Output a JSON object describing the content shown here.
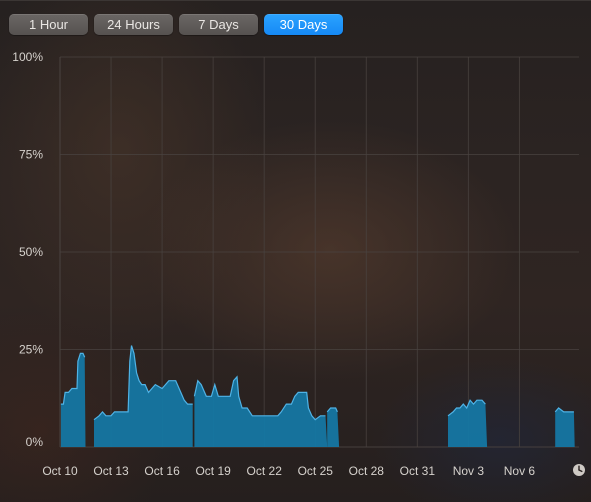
{
  "range_buttons": [
    {
      "label": "1 Hour",
      "active": false
    },
    {
      "label": "24 Hours",
      "active": false
    },
    {
      "label": "7 Days",
      "active": false
    },
    {
      "label": "30 Days",
      "active": true
    }
  ],
  "colors": {
    "accent": "#1a91f7",
    "area_fill": "#1577a3",
    "area_line": "#4fb3e6",
    "grid": "#4a4340"
  },
  "clock_icon": "clock-icon",
  "chart_data": {
    "type": "area",
    "ylabel": "",
    "xlabel": "",
    "ylim": [
      0,
      100
    ],
    "yticks": [
      0,
      25,
      50,
      75,
      100
    ],
    "ytick_labels": [
      "0%",
      "25%",
      "50%",
      "75%",
      "100%"
    ],
    "xlim": [
      0,
      30.5
    ],
    "xticks": [
      0,
      3,
      6,
      9,
      12,
      15,
      18,
      21,
      24,
      27
    ],
    "xtick_labels": [
      "Oct 10",
      "Oct 13",
      "Oct 16",
      "Oct 19",
      "Oct 22",
      "Oct 25",
      "Oct 28",
      "Oct 31",
      "Nov 3",
      "Nov 6"
    ],
    "grid": true,
    "segments": [
      {
        "name": "",
        "points": [
          [
            0.05,
            11
          ],
          [
            0.2,
            11
          ],
          [
            0.3,
            14
          ],
          [
            0.5,
            14
          ],
          [
            0.7,
            15
          ],
          [
            1.0,
            15
          ],
          [
            1.05,
            22
          ],
          [
            1.2,
            24
          ],
          [
            1.35,
            24
          ],
          [
            1.45,
            23
          ],
          [
            1.5,
            0
          ]
        ]
      },
      {
        "name": "",
        "points": [
          [
            2.0,
            7
          ],
          [
            2.3,
            8
          ],
          [
            2.5,
            9
          ],
          [
            2.7,
            8
          ],
          [
            3.0,
            8
          ],
          [
            3.2,
            9
          ],
          [
            3.6,
            9
          ],
          [
            4.0,
            9
          ],
          [
            4.1,
            22
          ],
          [
            4.2,
            26
          ],
          [
            4.35,
            24
          ],
          [
            4.5,
            19
          ],
          [
            4.65,
            17
          ],
          [
            4.8,
            16
          ],
          [
            5.0,
            16
          ],
          [
            5.2,
            14
          ],
          [
            5.6,
            16
          ],
          [
            6.0,
            15
          ],
          [
            6.4,
            17
          ],
          [
            6.8,
            17
          ],
          [
            7.1,
            14
          ],
          [
            7.3,
            12
          ],
          [
            7.5,
            11
          ],
          [
            7.8,
            11
          ]
        ]
      },
      {
        "name": "",
        "points": [
          [
            7.9,
            13
          ],
          [
            8.1,
            17
          ],
          [
            8.3,
            16
          ],
          [
            8.6,
            13
          ],
          [
            8.9,
            13
          ],
          [
            9.1,
            16
          ],
          [
            9.3,
            13
          ],
          [
            9.6,
            13
          ],
          [
            10.0,
            13
          ],
          [
            10.2,
            17
          ],
          [
            10.4,
            18
          ],
          [
            10.5,
            13
          ],
          [
            10.7,
            10
          ],
          [
            11.0,
            10
          ],
          [
            11.3,
            8
          ],
          [
            11.6,
            8
          ],
          [
            12.0,
            8
          ],
          [
            12.4,
            8
          ],
          [
            12.8,
            8
          ],
          [
            13.0,
            9
          ],
          [
            13.3,
            11
          ],
          [
            13.6,
            11
          ],
          [
            13.8,
            13
          ],
          [
            14.0,
            14
          ],
          [
            14.3,
            14
          ],
          [
            14.5,
            14
          ],
          [
            14.6,
            10
          ],
          [
            14.8,
            8
          ],
          [
            15.0,
            7
          ],
          [
            15.3,
            8
          ],
          [
            15.6,
            8
          ],
          [
            15.7,
            0
          ]
        ]
      },
      {
        "name": "",
        "points": [
          [
            15.7,
            9
          ],
          [
            15.9,
            10
          ],
          [
            16.2,
            10
          ],
          [
            16.3,
            9
          ],
          [
            16.4,
            0
          ]
        ]
      },
      {
        "name": "",
        "points": [
          [
            22.8,
            8
          ],
          [
            23.1,
            9
          ],
          [
            23.3,
            10
          ],
          [
            23.5,
            10
          ],
          [
            23.7,
            11
          ],
          [
            23.9,
            10
          ],
          [
            24.1,
            12
          ],
          [
            24.3,
            11
          ],
          [
            24.5,
            12
          ],
          [
            24.8,
            12
          ],
          [
            25.0,
            11
          ],
          [
            25.1,
            0
          ]
        ]
      },
      {
        "name": "",
        "points": [
          [
            29.1,
            9
          ],
          [
            29.3,
            10
          ],
          [
            29.6,
            9
          ],
          [
            29.9,
            9
          ],
          [
            30.2,
            9
          ],
          [
            30.25,
            0
          ]
        ]
      }
    ]
  }
}
